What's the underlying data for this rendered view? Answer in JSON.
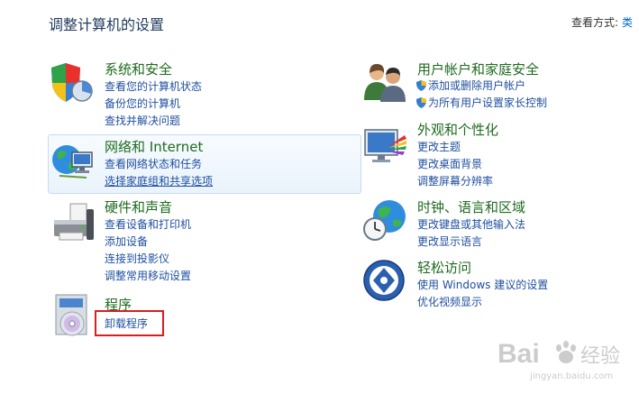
{
  "header": {
    "title": "调整计算机的设置",
    "view_label": "查看方式:",
    "view_value": "类"
  },
  "categories": {
    "system": {
      "title": "系统和安全",
      "links": [
        "查看您的计算机状态",
        "备份您的计算机",
        "查找并解决问题"
      ]
    },
    "network": {
      "title": "网络和 Internet",
      "links": [
        "查看网络状态和任务",
        "选择家庭组和共享选项"
      ]
    },
    "hardware": {
      "title": "硬件和声音",
      "links": [
        "查看设备和打印机",
        "添加设备",
        "连接到投影仪",
        "调整常用移动设置"
      ]
    },
    "programs": {
      "title": "程序",
      "links": [
        "卸载程序"
      ]
    },
    "users": {
      "title": "用户帐户和家庭安全",
      "links": [
        "添加或删除用户帐户",
        "为所有用户设置家长控制"
      ]
    },
    "appearance": {
      "title": "外观和个性化",
      "links": [
        "更改主题",
        "更改桌面背景",
        "调整屏幕分辨率"
      ]
    },
    "clock": {
      "title": "时钟、语言和区域",
      "links": [
        "更改键盘或其他输入法",
        "更改显示语言"
      ]
    },
    "ease": {
      "title": "轻松访问",
      "links": [
        "使用 Windows 建议的设置",
        "优化视频显示"
      ]
    }
  },
  "watermark": {
    "text": "Bai",
    "text2": "经验",
    "url": "jingyan.baidu.com"
  },
  "colors": {
    "title_green": "#1e6b1e",
    "link_blue": "#1f4fa0",
    "highlight_red": "#d6201f"
  }
}
